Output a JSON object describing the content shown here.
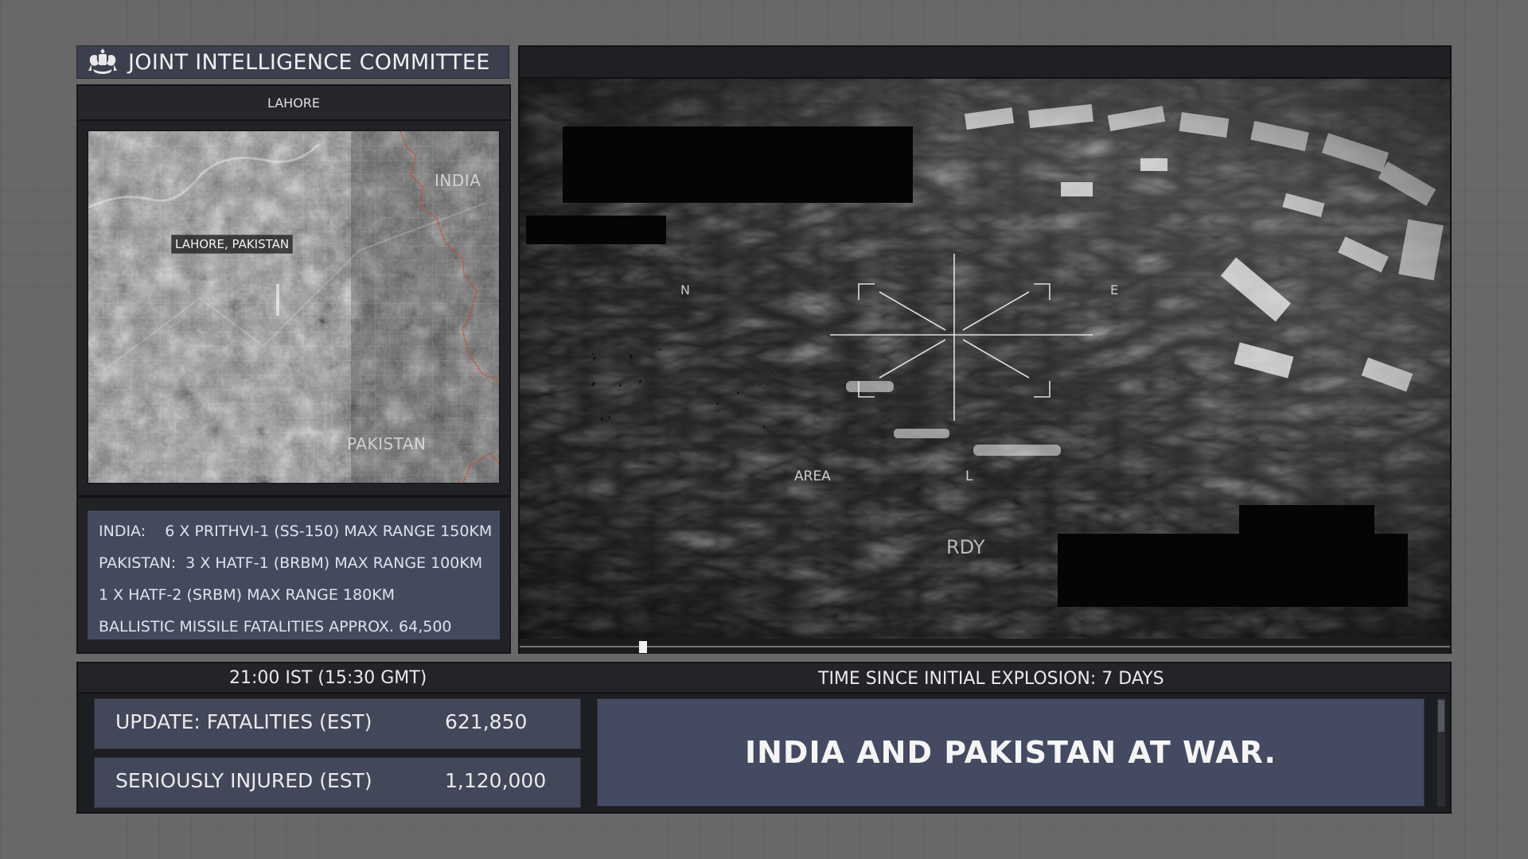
{
  "header": {
    "title": "JOINT INTELLIGENCE COMMITTEE",
    "crest_icon": "royal-crest-icon"
  },
  "left_panel": {
    "location": "LAHORE",
    "map": {
      "label_india": "INDIA",
      "label_pakistan": "PAKISTAN",
      "marker": "LAHORE, PAKISTAN",
      "border_color": "#c8482e"
    },
    "missiles": [
      "INDIA:    6 X PRITHVI-1 (SS-150) MAX RANGE 150KM",
      "PAKISTAN:  3 X HATF-1 (BRBM) MAX RANGE 100KM",
      "1 X HATF-2 (SRBM) MAX RANGE 180KM",
      "BALLISTIC MISSILE FATALITIES APPROX. 64,500"
    ]
  },
  "video": {
    "hud": {
      "n": "N",
      "e": "E",
      "area": "AREA",
      "l": "L",
      "rdy": "RDY"
    },
    "playback_progress": 0.128
  },
  "bottom": {
    "time_ist": "21:00 IST (15:30 GMT)",
    "time_since": "TIME SINCE INITIAL EXPLOSION: 7 DAYS",
    "fatalities_label": "UPDATE: FATALITIES (EST)",
    "fatalities_value": "621,850",
    "injured_label": "SERIOUSLY INJURED (EST)",
    "injured_value": "1,120,000",
    "headline": "INDIA AND PAKISTAN AT WAR."
  },
  "colors": {
    "panel_blue": "#434a61",
    "background": "#686868",
    "border_line": "#c8482e"
  }
}
